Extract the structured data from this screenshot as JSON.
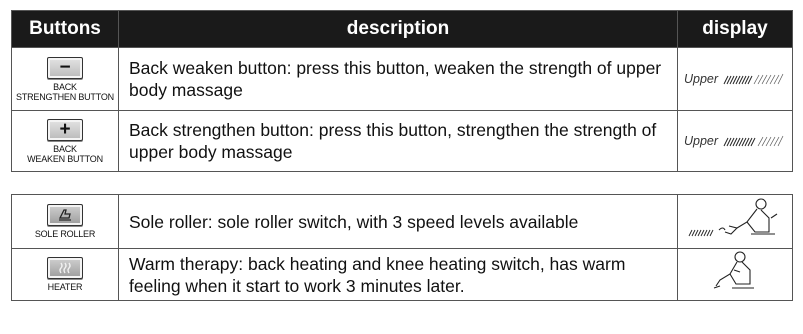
{
  "header": {
    "col_buttons": "Buttons",
    "col_description": "description",
    "col_display": "display"
  },
  "rows_top": [
    {
      "button_glyph": "−",
      "button_caption": "BACK\nSTRENGTHEN BUTTON",
      "description": "Back weaken button: press this button, weaken the strength of upper body massage",
      "display_text": "Upper"
    },
    {
      "button_glyph": "+",
      "button_caption": "BACK\nWEAKEN BUTTON",
      "description": "Back strengthen button: press this button, strengthen the strength of upper body massage",
      "display_text": "Upper"
    }
  ],
  "rows_bottom": [
    {
      "button_icon": "sole-roller-icon",
      "button_caption": "SOLE ROLLER",
      "description": "Sole roller: sole roller switch, with 3 speed levels available",
      "display_icon": "seated-person-sole-roller-icon"
    },
    {
      "button_icon": "heater-icon",
      "button_caption": "HEATER",
      "description": "Warm therapy: back heating and knee heating switch, has warm feeling when it start to work 3 minutes later.",
      "display_icon": "seated-person-icon"
    }
  ],
  "colors": {
    "header_bg": "#1a1a1a",
    "header_text": "#ffffff",
    "border": "#555555"
  }
}
